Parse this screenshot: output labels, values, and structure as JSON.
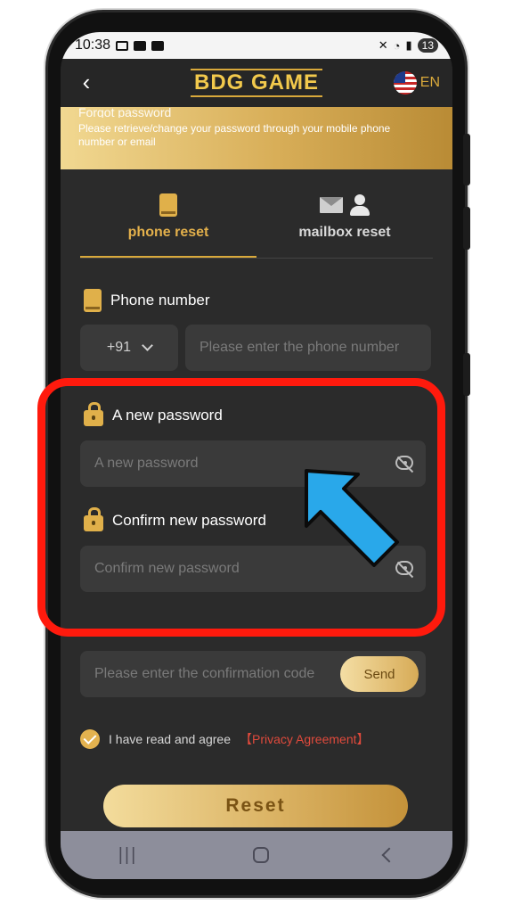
{
  "status_bar": {
    "time": "10:38",
    "battery": "13"
  },
  "header": {
    "logo": "BDG GAME",
    "lang": "EN"
  },
  "banner": {
    "title": "Forgot password",
    "description": "Please retrieve/change your password through your mobile phone number or email"
  },
  "tabs": [
    {
      "label": "phone reset",
      "active": true,
      "icon": "phone-icon"
    },
    {
      "label": "mailbox reset",
      "active": false,
      "icon": "mail-person-icon"
    }
  ],
  "phone": {
    "label": "Phone number",
    "country_code": "+91",
    "placeholder": "Please enter the phone number"
  },
  "new_password": {
    "label": "A new password",
    "placeholder": "A new password"
  },
  "confirm_password": {
    "label": "Confirm new password",
    "placeholder": "Confirm new password"
  },
  "code": {
    "placeholder": "Please enter the confirmation code",
    "send_label": "Send"
  },
  "agreement": {
    "text": "I have read and agree",
    "link": "【Privacy Agreement】"
  },
  "reset_label": "Reset",
  "colors": {
    "accent": "#e3b04b",
    "highlight": "#ff1a0d",
    "arrow": "#29a8ea",
    "link": "#e04a3c"
  }
}
